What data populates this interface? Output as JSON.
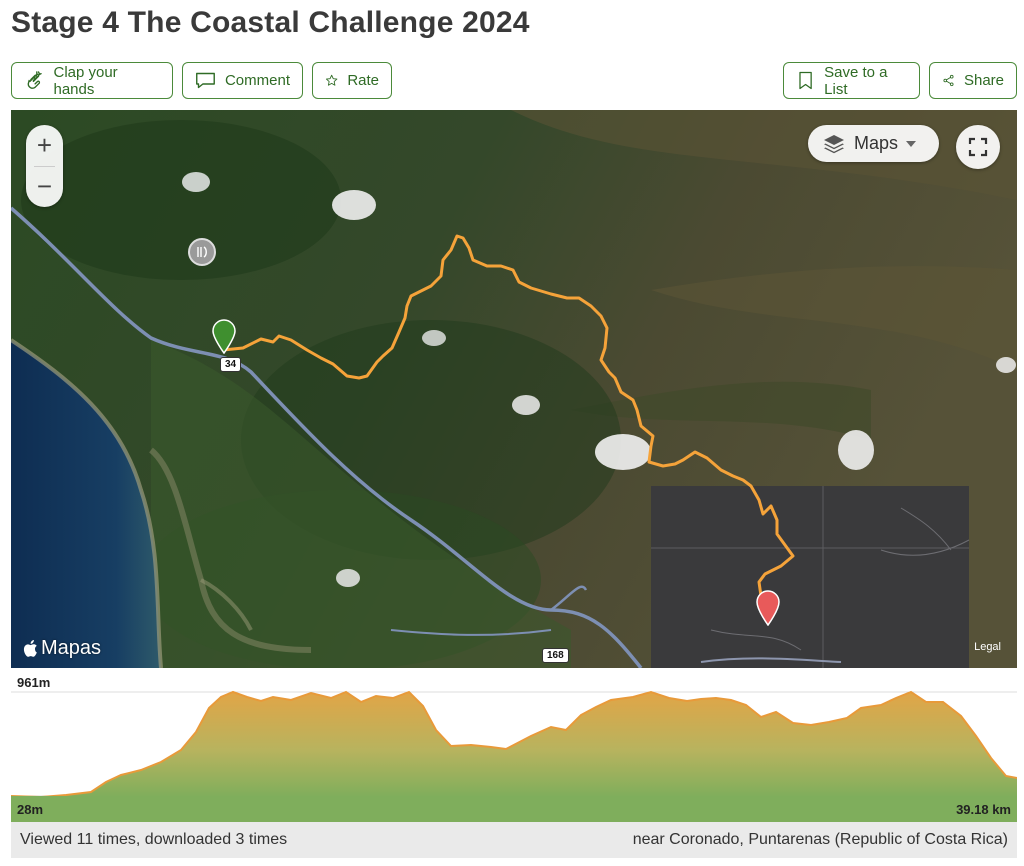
{
  "page": {
    "title": "Stage 4 The Coastal Challenge 2024"
  },
  "actions": {
    "clap": {
      "label": "Clap your hands",
      "icon": "clap-hands-icon"
    },
    "comment": {
      "label": "Comment",
      "icon": "comment-icon"
    },
    "rate": {
      "label": "Rate",
      "icon": "star-icon"
    },
    "save": {
      "label": "Save to a List",
      "icon": "bookmark-icon"
    },
    "share": {
      "label": "Share",
      "icon": "share-icon"
    }
  },
  "map": {
    "zoom_in": "+",
    "zoom_out": "−",
    "layer_label": "Maps",
    "watermark": "Mapas",
    "legal": "Legal",
    "road_labels": [
      "34",
      "168"
    ],
    "route_color": "#f5a33a",
    "start_marker_color": "#3f8f2f",
    "end_marker_color": "#e85a5a"
  },
  "elevation": {
    "max_label": "961m",
    "min_label": "28m",
    "distance_label": "39.18 km"
  },
  "footer": {
    "views": "Viewed 11 times, downloaded 3 times",
    "location": "near Coronado, Puntarenas (Republic of Costa Rica)"
  }
}
